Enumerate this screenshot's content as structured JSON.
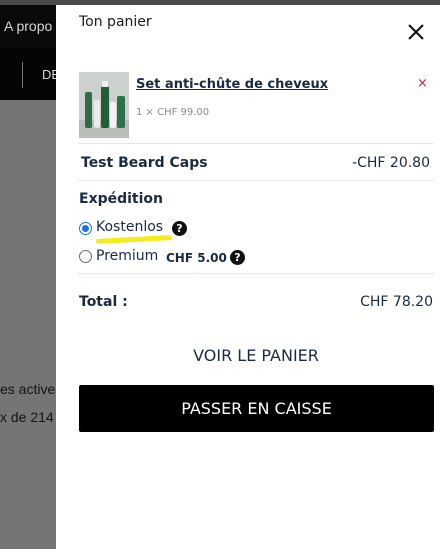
{
  "background": {
    "announcement_text": "A propo",
    "nav_text": "DE",
    "line1": "es active",
    "line2": "x de 214"
  },
  "cart": {
    "title": "Ton panier",
    "close_icon": "close-icon",
    "item": {
      "name": "Set anti-chûte de cheveux",
      "quantity_price": "1 × CHF 99.00",
      "remove_symbol": "×"
    },
    "discount": {
      "label": "Test Beard Caps",
      "value": "-CHF 20.80"
    },
    "shipping": {
      "title": "Expédition",
      "options": [
        {
          "label": "Kostenlos",
          "price": "",
          "selected": true
        },
        {
          "label": "Premium",
          "price": "CHF 5.00",
          "selected": false
        }
      ],
      "help_symbol": "?"
    },
    "total": {
      "label": "Total :",
      "value": "CHF 78.20"
    },
    "view_cart_label": "VOIR LE PANIER",
    "checkout_label": "PASSER EN CAISSE"
  },
  "colors": {
    "accent": "#1a73e8",
    "highlight": "#f4ec1c",
    "remove": "#cc2222",
    "button": "#000000"
  }
}
